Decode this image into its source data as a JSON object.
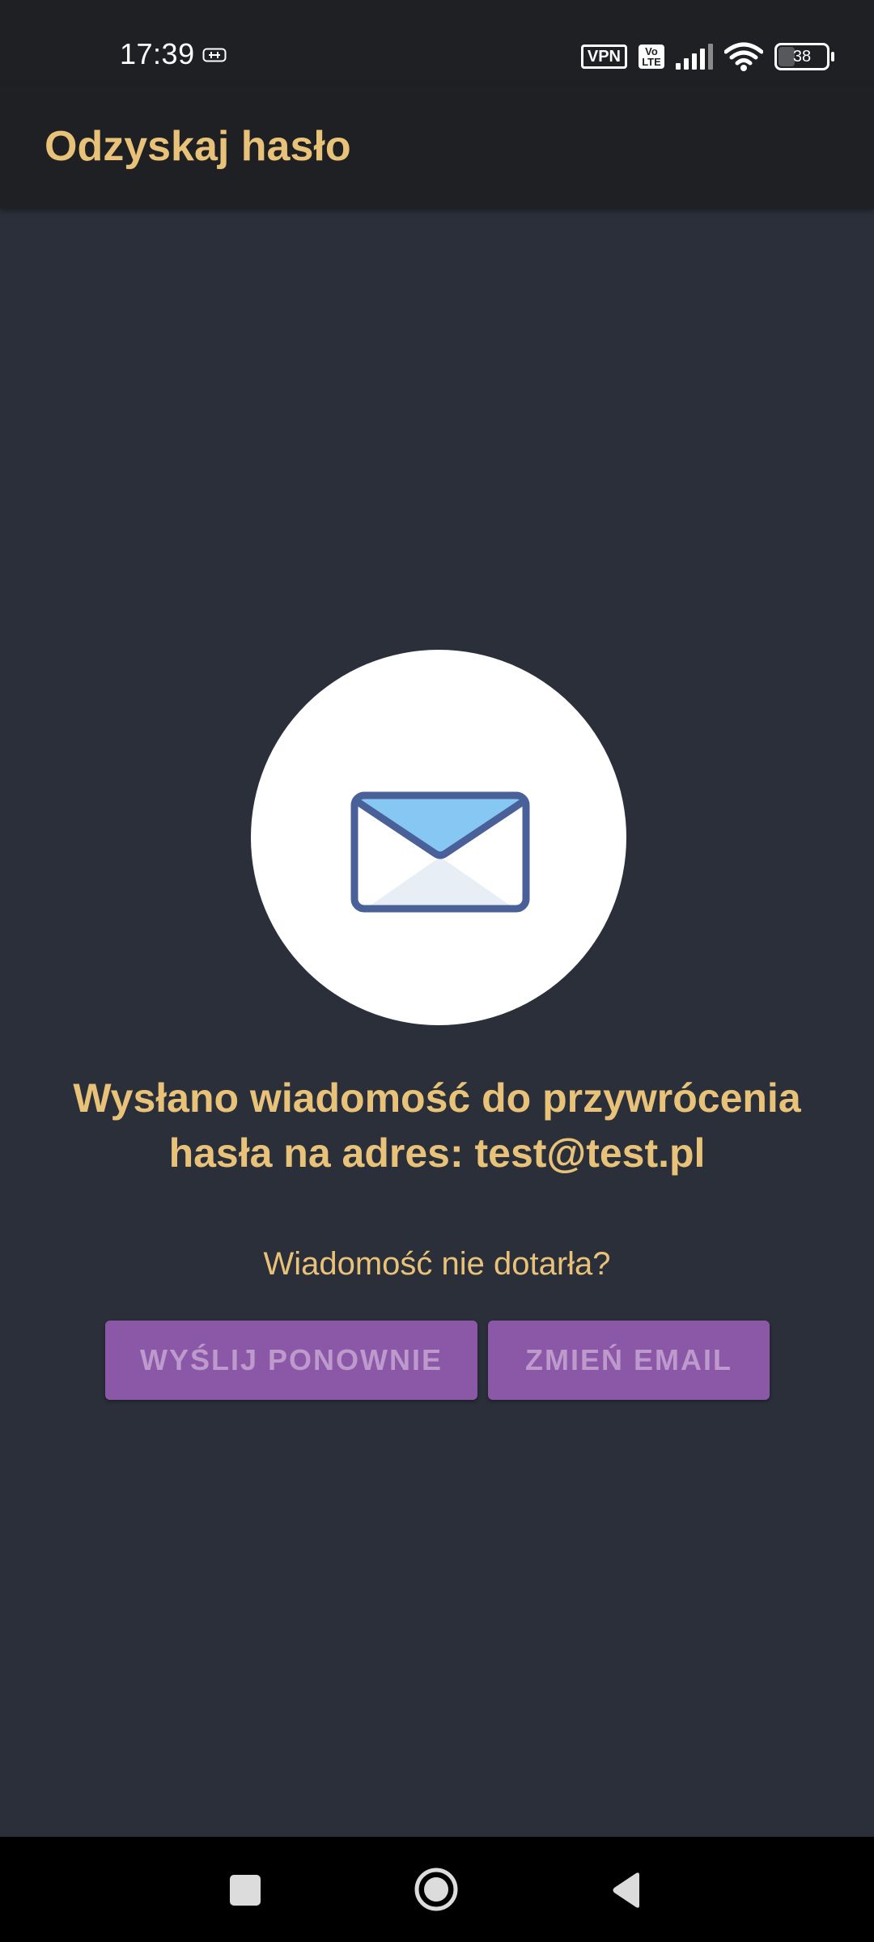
{
  "status_bar": {
    "time": "17:39",
    "vpn_label": "VPN",
    "volte_top": "Vo",
    "volte_bottom": "LTE",
    "battery_percent": "38",
    "battery_level": 0.38
  },
  "app_bar": {
    "title": "Odzyskaj hasło"
  },
  "main": {
    "message": "Wysłano wiadomość do przywrócenia hasła na adres: test@test.pl",
    "question": "Wiadomość nie dotarła?",
    "resend_label": "WYŚLIJ PONOWNIE",
    "change_email_label": "ZMIEŃ EMAIL",
    "icon": "envelope-icon"
  },
  "colors": {
    "background": "#2a2f39",
    "app_bar": "#1f2024",
    "accent_text": "#e9c27a",
    "button": "#8b58a8",
    "button_text": "#bd9acb",
    "envelope_stroke": "#4a6098",
    "envelope_flap": "#86c8f3"
  },
  "nav_bar": {
    "items": [
      "recents-icon",
      "home-icon",
      "back-icon"
    ]
  }
}
